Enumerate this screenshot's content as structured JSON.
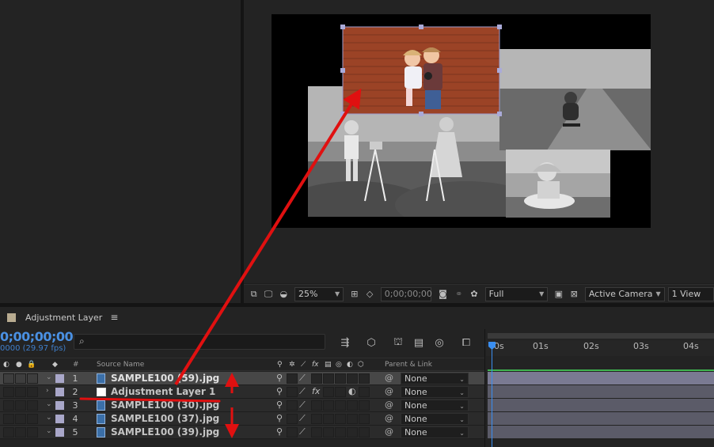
{
  "viewer": {
    "zoom": "25%",
    "timecode": "0;00;00;00",
    "resolution": "Full",
    "camera": "Active Camera",
    "views": "1 View"
  },
  "timeline": {
    "tab_title": "Adjustment Layer",
    "tab_menu_glyph": "≡",
    "timecode": "0;00;00;00",
    "fps": "0000 (29.97 fps)",
    "search_glyph": "⌕",
    "columns": {
      "num": "#",
      "source_name": "Source Name",
      "parent_link": "Parent & Link",
      "switch_fx": "fx"
    },
    "ruler_ticks": [
      "0s",
      "01s",
      "02s",
      "03s",
      "04s"
    ],
    "layers": [
      {
        "num": "1",
        "name": "SAMPLE100 (59).jpg",
        "parent": "None",
        "type": "image",
        "selected": true
      },
      {
        "num": "2",
        "name": "Adjustment Layer 1",
        "parent": "None",
        "type": "adjustment",
        "selected": false
      },
      {
        "num": "3",
        "name": "SAMPLE100 (30).jpg",
        "parent": "None",
        "type": "image",
        "selected": false
      },
      {
        "num": "4",
        "name": "SAMPLE100 (37).jpg",
        "parent": "None",
        "type": "image",
        "selected": false
      },
      {
        "num": "5",
        "name": "SAMPLE100 (39).jpg",
        "parent": "None",
        "type": "image",
        "selected": false
      }
    ]
  },
  "colors": {
    "timecode_blue": "#4a90e2",
    "annotation_red": "#e01010",
    "label_lavender": "#a9a7c9",
    "work_area_green": "#3fb34f"
  }
}
